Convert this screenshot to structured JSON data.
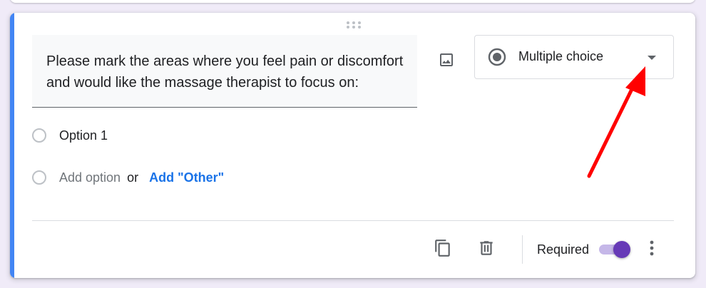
{
  "question": {
    "title": "Please mark the areas where you feel pain or discomfort and would like the massage therapist to focus on:"
  },
  "type_select": {
    "selected": "Multiple choice"
  },
  "options": [
    {
      "label": "Option 1"
    }
  ],
  "add_option": {
    "label": "Add option",
    "or_text": "or",
    "other_label": "Add \"Other\""
  },
  "footer": {
    "required_label": "Required",
    "required_on": true
  },
  "colors": {
    "accent": "#4285f4",
    "toggle_on": "#673ab7",
    "link": "#1a73e8",
    "annotation": "#ff0000"
  },
  "icons": [
    "drag-handle-icon",
    "image-icon",
    "radio-checked-icon",
    "caret-down-icon",
    "duplicate-icon",
    "trash-icon",
    "more-vert-icon"
  ]
}
